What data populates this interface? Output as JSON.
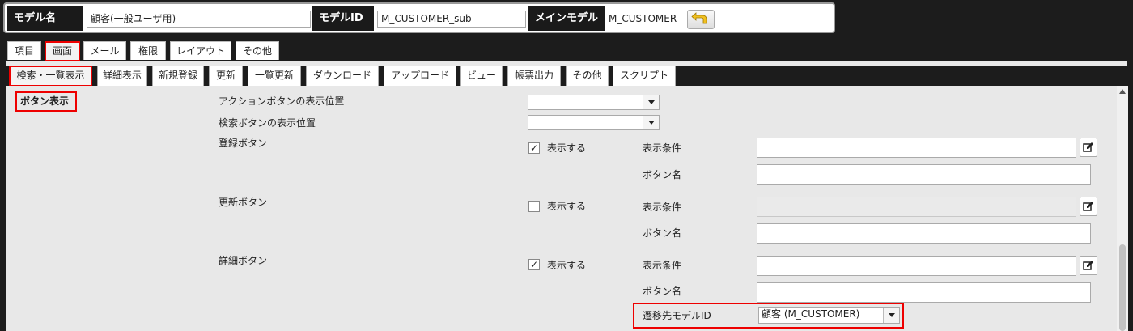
{
  "header": {
    "model_name_label": "モデル名",
    "model_name_value": "顧客(一般ユーザ用)",
    "model_id_label": "モデルID",
    "model_id_value": "M_CUSTOMER_sub",
    "main_model_label": "メインモデル",
    "main_model_value": "M_CUSTOMER"
  },
  "tabs_top": [
    "項目",
    "画面",
    "メール",
    "権限",
    "レイアウト",
    "その他"
  ],
  "tabs_screen": [
    "検索・一覧表示",
    "詳細表示",
    "新規登録",
    "更新",
    "一覧更新",
    "ダウンロード",
    "アップロード",
    "ビュー",
    "帳票出力",
    "その他",
    "スクリプト"
  ],
  "section": {
    "title": "ボタン表示",
    "action_button_position_label": "アクションボタンの表示位置",
    "action_button_position_value": "",
    "search_button_position_label": "検索ボタンの表示位置",
    "search_button_position_value": "",
    "register_button": {
      "label": "登録ボタン",
      "show_label": "表示する",
      "checked": true,
      "condition_label": "表示条件",
      "name_label": "ボタン名"
    },
    "update_button": {
      "label": "更新ボタン",
      "show_label": "表示する",
      "checked": false,
      "condition_label": "表示条件",
      "name_label": "ボタン名"
    },
    "detail_button": {
      "label": "詳細ボタン",
      "show_label": "表示する",
      "checked": true,
      "condition_label": "表示条件",
      "name_label": "ボタン名",
      "target_model_label": "遷移先モデルID",
      "target_model_value": "顧客 (M_CUSTOMER)"
    }
  },
  "colors": {
    "highlight": "#e00000",
    "header_bg": "#1a1a1a",
    "panel_bg": "#e8e8e8"
  }
}
